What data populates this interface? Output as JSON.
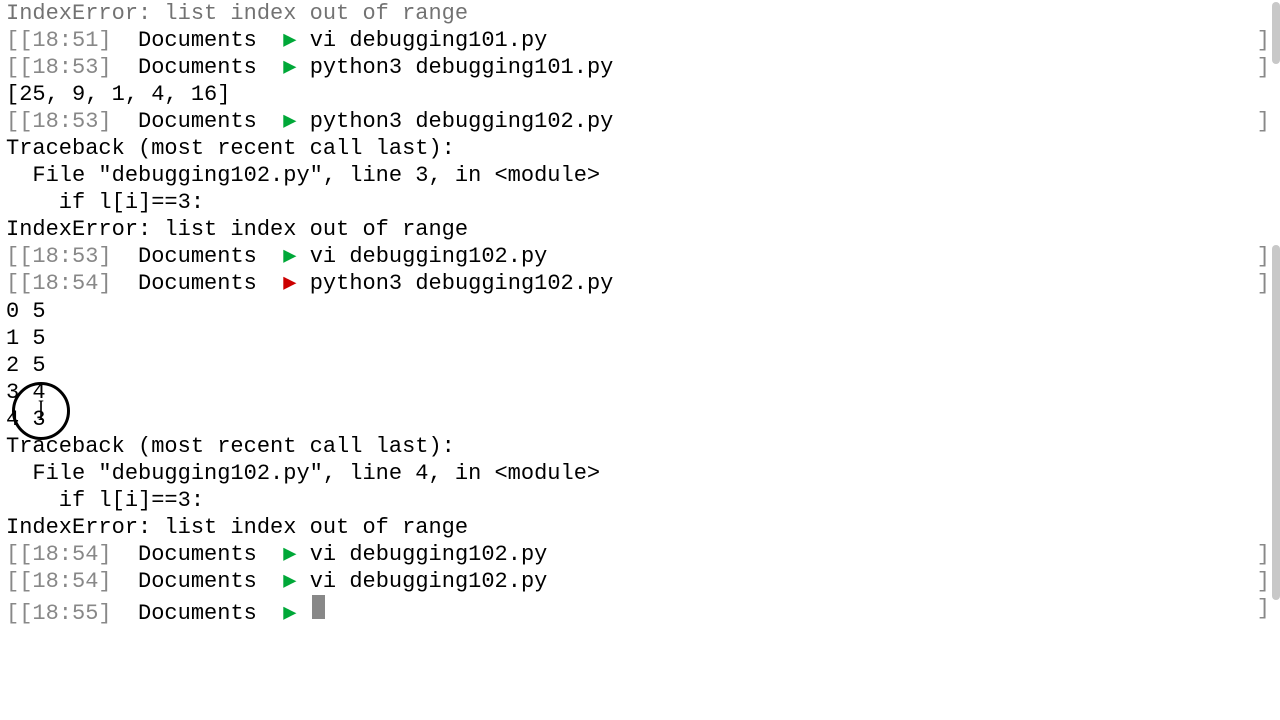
{
  "lines": [
    {
      "type": "output",
      "text": "IndexError: list index out of range",
      "faded": true
    },
    {
      "type": "prompt",
      "time": "18:51",
      "loc": "Documents",
      "arrow": "green",
      "cmd": "vi debugging101.py"
    },
    {
      "type": "prompt",
      "time": "18:53",
      "loc": "Documents",
      "arrow": "green",
      "cmd": "python3 debugging101.py"
    },
    {
      "type": "output",
      "text": "[25, 9, 1, 4, 16]"
    },
    {
      "type": "prompt",
      "time": "18:53",
      "loc": "Documents",
      "arrow": "green",
      "cmd": "python3 debugging102.py"
    },
    {
      "type": "output",
      "text": "Traceback (most recent call last):"
    },
    {
      "type": "output",
      "text": "  File \"debugging102.py\", line 3, in <module>"
    },
    {
      "type": "output",
      "text": "    if l[i]==3:"
    },
    {
      "type": "output",
      "text": "IndexError: list index out of range"
    },
    {
      "type": "prompt",
      "time": "18:53",
      "loc": "Documents",
      "arrow": "green",
      "cmd": "vi debugging102.py"
    },
    {
      "type": "prompt",
      "time": "18:54",
      "loc": "Documents",
      "arrow": "red",
      "cmd": "python3 debugging102.py"
    },
    {
      "type": "output",
      "text": "0 5"
    },
    {
      "type": "output",
      "text": "1 5"
    },
    {
      "type": "output",
      "text": "2 5"
    },
    {
      "type": "output",
      "text": "3 4"
    },
    {
      "type": "output",
      "text": "4 3"
    },
    {
      "type": "output",
      "text": "Traceback (most recent call last):"
    },
    {
      "type": "output",
      "text": "  File \"debugging102.py\", line 4, in <module>"
    },
    {
      "type": "output",
      "text": "    if l[i]==3:"
    },
    {
      "type": "output",
      "text": "IndexError: list index out of range"
    },
    {
      "type": "prompt",
      "time": "18:54",
      "loc": "Documents",
      "arrow": "green",
      "cmd": "vi debugging102.py"
    },
    {
      "type": "prompt",
      "time": "18:54",
      "loc": "Documents",
      "arrow": "green",
      "cmd": "vi debugging102.py"
    },
    {
      "type": "prompt",
      "time": "18:55",
      "loc": "Documents",
      "arrow": "green",
      "cmd": "",
      "cursor": true
    }
  ],
  "arrow_glyph": "▶",
  "ibeam_glyph": "I"
}
